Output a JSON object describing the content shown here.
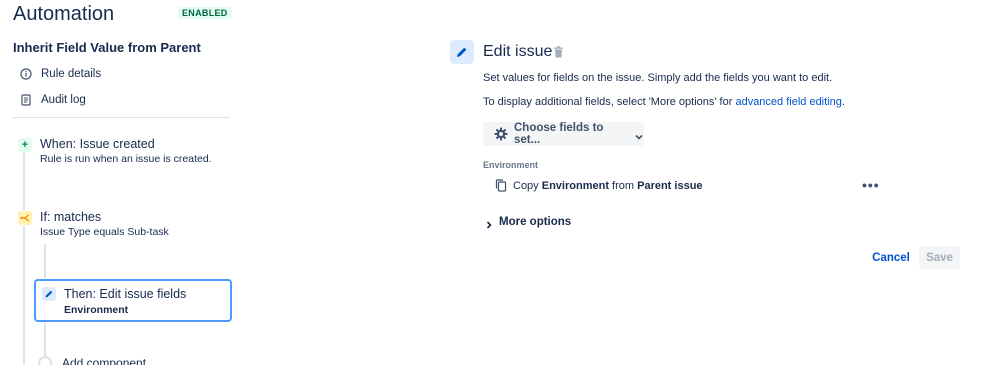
{
  "app": {
    "title": "Automation",
    "status_badge": "ENABLED"
  },
  "rule": {
    "name": "Inherit Field Value from Parent",
    "links": [
      {
        "label": "Rule details",
        "icon": "info-icon"
      },
      {
        "label": "Audit log",
        "icon": "document-icon"
      }
    ]
  },
  "steps": {
    "trigger": {
      "title": "When: Issue created",
      "subtitle": "Rule is run when an issue is created.",
      "icon": "plus-icon"
    },
    "condition": {
      "title": "If: matches",
      "subtitle": "Issue Type equals Sub-task",
      "icon": "branch-icon"
    },
    "action": {
      "title": "Then: Edit issue fields",
      "subtitle": "Environment",
      "icon": "pencil-icon"
    },
    "add_component": "Add component"
  },
  "editor": {
    "title": "Edit issue",
    "description": "Set values for fields on the issue. Simply add the fields you want to edit.",
    "additional_prefix": "To display additional fields, select 'More options' for ",
    "additional_link": "advanced field editing",
    "additional_suffix": ".",
    "choose_fields_label": "Choose fields to set...",
    "field": {
      "label": "Environment",
      "copy_prefix": "Copy ",
      "copy_field": "Environment",
      "copy_mid": " from ",
      "copy_source": "Parent issue"
    },
    "more_options": "More options",
    "cancel": "Cancel",
    "save": "Save"
  },
  "colors": {
    "accent": "#0052cc",
    "enabled_bg": "#e3fcef",
    "enabled_text": "#006644",
    "selected_border": "#4c9aff",
    "condition_badge": "#fff0b3"
  }
}
